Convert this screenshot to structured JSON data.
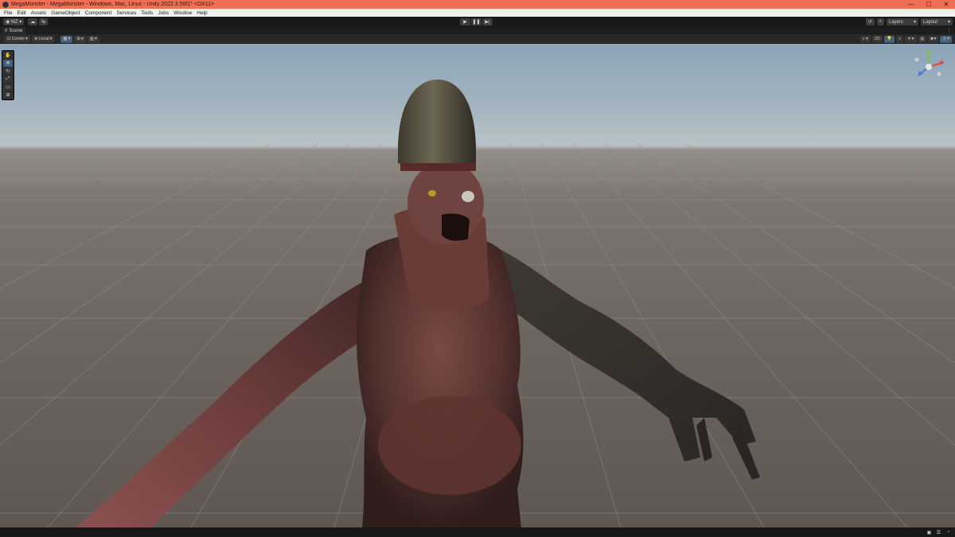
{
  "window": {
    "title": "MegaMonster - MegaMonster - Windows, Mac, Linux - Unity 2022.3.56f1* <DX11>",
    "controls": {
      "minimize": "—",
      "maximize": "☐",
      "close": "✕"
    }
  },
  "menu": [
    "File",
    "Edit",
    "Assets",
    "GameObject",
    "Component",
    "Services",
    "Tools",
    "Jobs",
    "Window",
    "Help"
  ],
  "toolbar": {
    "account": "MZ",
    "layers": "Layers",
    "layout": "Layout"
  },
  "scene_tab": {
    "label": "Scene"
  },
  "scene_toolbar": {
    "pivot": "Center",
    "space": "Local",
    "mode_2d": "2D"
  },
  "colors": {
    "title_bar": "#f06e54",
    "editor_dark": "#1f1f1f",
    "accent": "#46607c"
  },
  "icons": [
    "unity-icon",
    "account-icon",
    "cloud-icon",
    "collab-icon",
    "play-icon",
    "pause-icon",
    "step-icon",
    "history-icon",
    "search-icon",
    "hand-tool-icon",
    "move-tool-icon",
    "rotate-tool-icon",
    "scale-tool-icon",
    "rect-tool-icon",
    "transform-tool-icon",
    "scene-gizmo-icon"
  ]
}
